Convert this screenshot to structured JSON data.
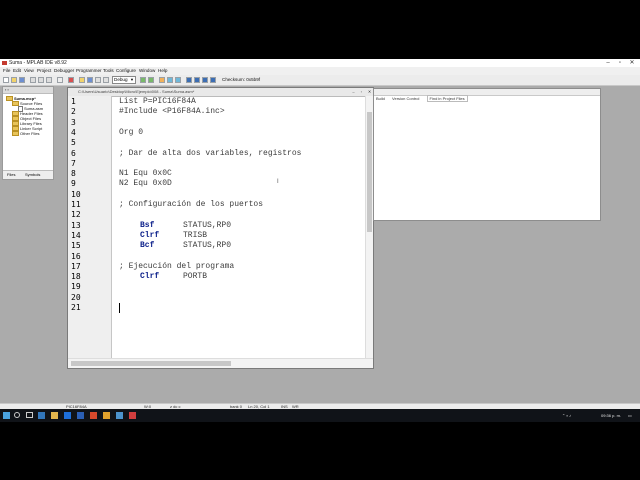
{
  "window": {
    "title": "Suma - MPLAB IDE v8.92"
  },
  "menu": [
    "File",
    "Edit",
    "View",
    "Project",
    "Debugger",
    "Programmer",
    "Tools",
    "Configure",
    "Window",
    "Help"
  ],
  "toolbar": {
    "build_config": "Debug",
    "checksum": "Checksum:  0x5b9f"
  },
  "project_window": {
    "root": "Suma.mcp*",
    "items": [
      {
        "label": "Source Files",
        "type": "folder"
      },
      {
        "label": "Suma.asm",
        "type": "file"
      },
      {
        "label": "Header Files",
        "type": "folder"
      },
      {
        "label": "Object Files",
        "type": "folder"
      },
      {
        "label": "Library Files",
        "type": "folder"
      },
      {
        "label": "Linker Script",
        "type": "folder"
      },
      {
        "label": "Other Files",
        "type": "folder"
      }
    ],
    "tabs": [
      "Files",
      "Symbols"
    ]
  },
  "editor": {
    "title": "C:\\Users\\Usuario\\Desktop\\Micro\\Ejemplo\\008 - Suma\\Suma.asm*",
    "lines": [
      {
        "n": "1",
        "text": "List P=PIC16F84A",
        "style": "cm"
      },
      {
        "n": "2",
        "text": "#Include <P16F84A.inc>",
        "style": "cm"
      },
      {
        "n": "3",
        "text": "",
        "style": "cm"
      },
      {
        "n": "4",
        "text": "Org 0",
        "style": "cm"
      },
      {
        "n": "5",
        "text": "",
        "style": "cm"
      },
      {
        "n": "6",
        "text": "; Dar de alta dos variables, registros",
        "style": "cm"
      },
      {
        "n": "7",
        "text": "",
        "style": "cm"
      },
      {
        "n": "8",
        "text": "N1 Equ 0x0C",
        "style": "cm"
      },
      {
        "n": "9",
        "text": "N2 Equ 0x0D",
        "style": "cm"
      },
      {
        "n": "10",
        "text": "",
        "style": "cm"
      },
      {
        "n": "11",
        "text": "; Configuración de los puertos",
        "style": "cm"
      },
      {
        "n": "12",
        "text": "",
        "style": "cm"
      },
      {
        "n": "13",
        "op": "Bsf",
        "arg": "STATUS,RP0"
      },
      {
        "n": "14",
        "op": "Clrf",
        "arg": "TRISB"
      },
      {
        "n": "15",
        "op": "Bcf",
        "arg": "STATUS,RP0"
      },
      {
        "n": "16",
        "text": "",
        "style": "cm"
      },
      {
        "n": "17",
        "text": "; Ejecución del programa",
        "style": "cm"
      },
      {
        "n": "18",
        "op": "Clrf",
        "arg": "PORTB"
      },
      {
        "n": "19",
        "text": "",
        "style": "cm"
      },
      {
        "n": "20",
        "text": "",
        "style": "cm"
      },
      {
        "n": "21",
        "text": "",
        "style": "cm"
      }
    ],
    "stray_mark": "I"
  },
  "output_window": {
    "tabs": [
      "Build",
      "Version Control",
      "Find in Project Files"
    ]
  },
  "statusbar": {
    "device": "PIC16F84A",
    "wreg": "W:0",
    "flags": "z dc c",
    "bank": "bank 0",
    "position": "Ln 20, Col 1",
    "ins": "INS",
    "wr": "WR"
  },
  "taskbar": {
    "clock": "09:36 p. m."
  }
}
